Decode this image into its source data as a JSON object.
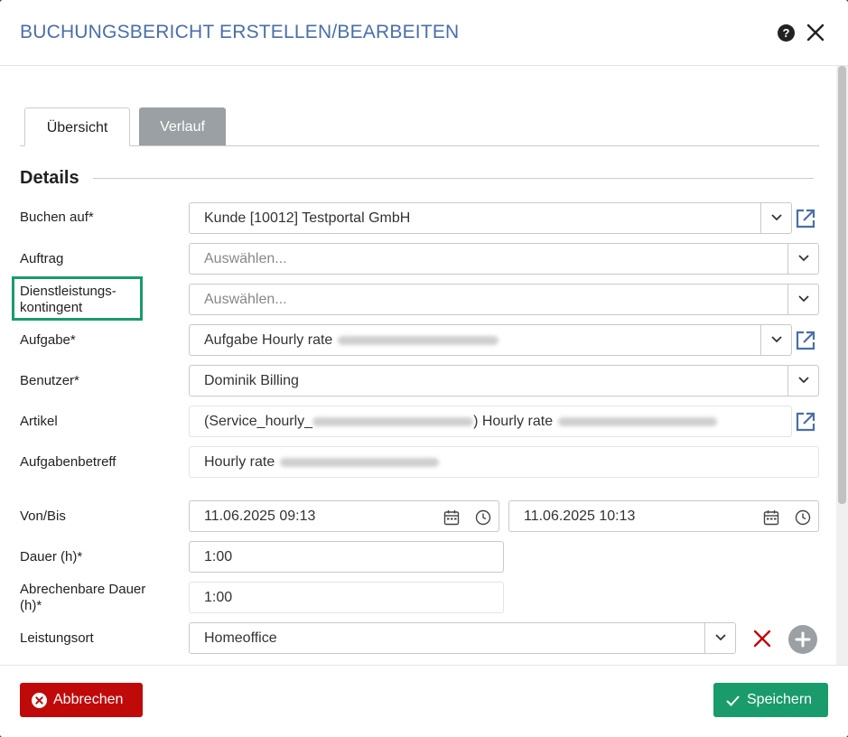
{
  "dialog": {
    "title": "BUCHUNGSBERICHT ERSTELLEN/BEARBEITEN",
    "help_icon": "question-circle-icon",
    "close_icon": "close-icon"
  },
  "tabs": [
    {
      "label": "Übersicht",
      "active": true
    },
    {
      "label": "Verlauf",
      "active": false
    }
  ],
  "section": {
    "title": "Details"
  },
  "fields": {
    "buchen_auf": {
      "label": "Buchen auf*",
      "value": "Kunde [10012] Testportal GmbH"
    },
    "auftrag": {
      "label": "Auftrag",
      "placeholder": "Auswählen..."
    },
    "kontingent": {
      "label_line1": "Dienstleistungs-",
      "label_line2": "kontingent",
      "placeholder": "Auswählen..."
    },
    "aufgabe": {
      "label": "Aufgabe*",
      "value": "Aufgabe Hourly rate"
    },
    "benutzer": {
      "label": "Benutzer*",
      "value": "Dominik Billing"
    },
    "artikel": {
      "label": "Artikel",
      "value_prefix": "(Service_hourly_",
      "value_middle": ") Hourly rate"
    },
    "aufgabenbetreff": {
      "label": "Aufgabenbetreff",
      "value": "Hourly rate"
    },
    "von_bis": {
      "label": "Von/Bis",
      "von": "11.06.2025 09:13",
      "bis": "11.06.2025 10:13"
    },
    "dauer": {
      "label": "Dauer (h)*",
      "value": "1:00"
    },
    "abrechenbare_dauer": {
      "label_line1": "Abrechenbare Dauer",
      "label_line2": "(h)*",
      "value": "1:00"
    },
    "leistungsort": {
      "label": "Leistungsort",
      "value": "Homeoffice"
    }
  },
  "footer": {
    "cancel_label": "Abbrechen",
    "save_label": "Speichern"
  },
  "colors": {
    "title": "#4a6ea8",
    "cancel": "#c00a0a",
    "save": "#1a9b6c",
    "highlight": "#1a9b6c",
    "tab_inactive": "#9aa0a3"
  }
}
